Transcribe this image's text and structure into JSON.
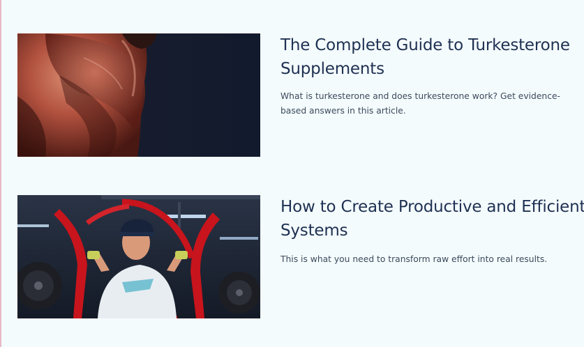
{
  "articles": [
    {
      "title": "The Complete Guide to Turkesterone Supplements",
      "excerpt": "What is turkesterone and does turkesterone work? Get evidence-based answers in this article.",
      "image_icon": "bodybuilder-back-photo"
    },
    {
      "title": "How to Create Productive and Efficient Systems",
      "excerpt": "This is what you need to transform raw effort into real results.",
      "image_icon": "gym-chest-press-photo"
    }
  ],
  "colors": {
    "background": "#f4fbfc",
    "title": "#1f3153",
    "excerpt": "#3a4a5c",
    "equipment_red": "#c8141c"
  }
}
